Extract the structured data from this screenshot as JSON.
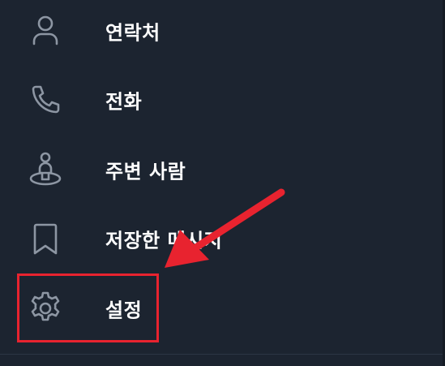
{
  "menu": {
    "items": [
      {
        "label": "연락처",
        "icon": "person-icon"
      },
      {
        "label": "전화",
        "icon": "phone-icon"
      },
      {
        "label": "주변 사람",
        "icon": "nearby-people-icon"
      },
      {
        "label": "저장한 메시지",
        "icon": "bookmark-icon"
      },
      {
        "label": "설정",
        "icon": "gear-icon"
      }
    ]
  },
  "annotation": {
    "highlight_color": "#e8232f",
    "target": "설정"
  },
  "colors": {
    "background": "#1c2430",
    "icon": "#8d96a3",
    "label": "#ffffff"
  }
}
